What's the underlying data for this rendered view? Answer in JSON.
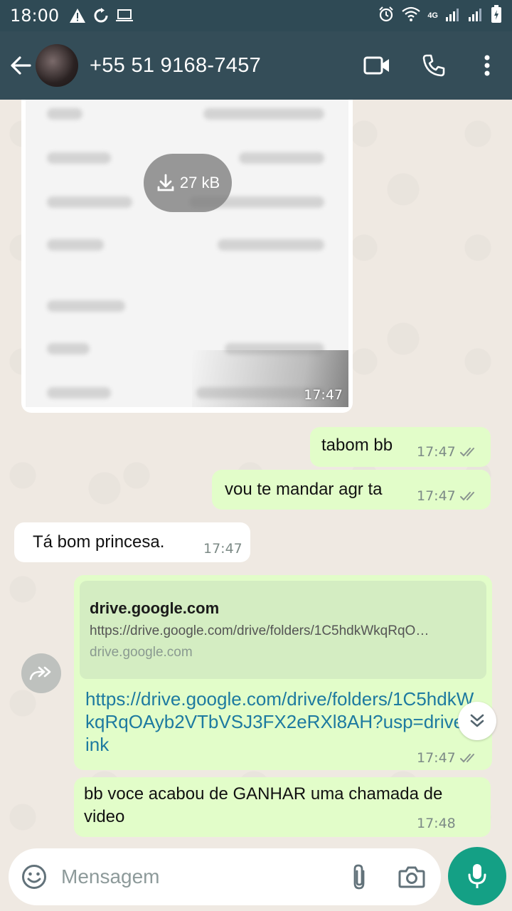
{
  "status_bar": {
    "time": "18:00",
    "network": "4G"
  },
  "header": {
    "contact": "+55 51 9168-7457"
  },
  "messages": {
    "doc": {
      "size": "27 kB",
      "time": "17:47"
    },
    "m1": {
      "text": "tabom bb",
      "time": "17:47"
    },
    "m2": {
      "text": "vou te mandar agr ta",
      "time": "17:47"
    },
    "m3": {
      "text": "Tá bom princesa.",
      "time": "17:47"
    },
    "link": {
      "title": "drive.google.com",
      "url": "https://drive.google.com/drive/folders/1C5hdkWkqRqO…",
      "domain": "drive.google.com",
      "body": "https://drive.google.com/drive/folders/1C5hdkWkqRqOAyb2VTbVSJ3FX2eRXl8AH?usp=drive_link",
      "time": "17:47"
    },
    "m5": {
      "text": "bb voce acabou de GANHAR uma chamada de video",
      "time": "17:48"
    }
  },
  "composer": {
    "placeholder": "Mensagem"
  },
  "colors": {
    "header": "#344d58",
    "outgoing": "#e2fdc9",
    "incoming": "#ffffff",
    "accent": "#14a085",
    "link": "#1d7aa0"
  }
}
